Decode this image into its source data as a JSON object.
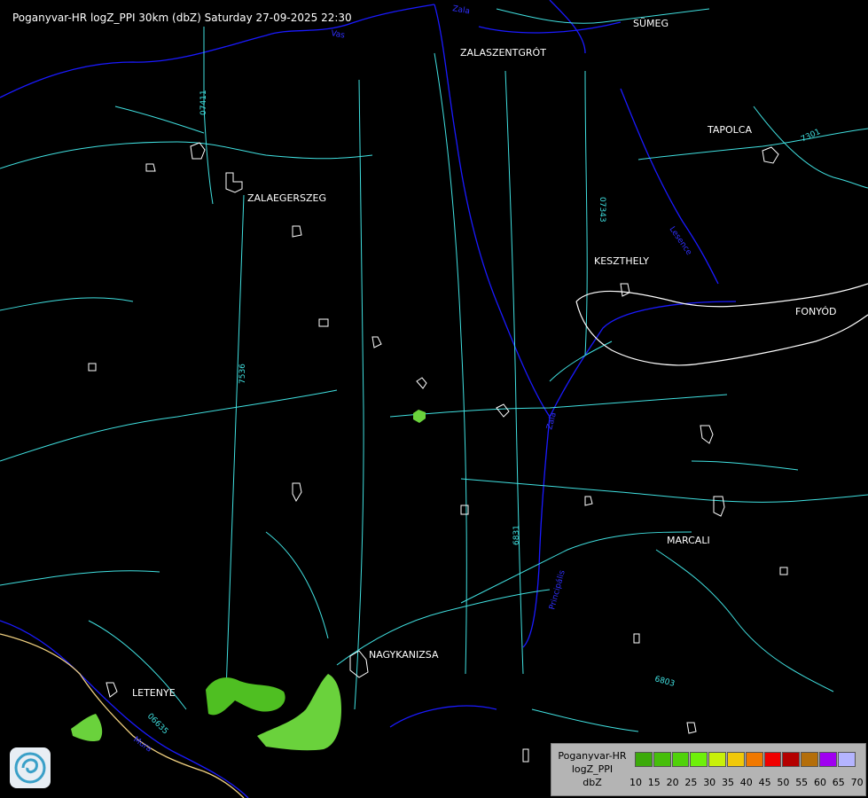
{
  "map": {
    "title": "Poganyvar-HR logZ_PPI 30km (dbZ) Saturday 27-09-2025 22:30",
    "cities": [
      "SÜMEG",
      "ZALASZENTGRÓT",
      "TAPOLCA",
      "ZALAEGERSZEG",
      "KESZTHELY",
      "FONYÓD",
      "MARCALI",
      "NAGYKANIZSA",
      "LETENYE"
    ],
    "road_labels": [
      "07411",
      "07343",
      "7536",
      "6831",
      "6803",
      "06635",
      "7301"
    ],
    "river_labels": [
      "Zala",
      "Vas",
      "Zala",
      "Principális",
      "Lesence",
      "Mura"
    ],
    "colors": {
      "background": "#000000",
      "roads": "#40e0e0",
      "rivers": "#1a1aff",
      "boundaries": "#ffffff",
      "border": "#f0d080",
      "echo_light": "#6ad23c",
      "echo_dark": "#3cb41e"
    }
  },
  "legend": {
    "line1": "Poganyvar-HR",
    "line2": "logZ_PPI",
    "line3": "dbZ",
    "swatch_colors": [
      "#3caa0a",
      "#46be0a",
      "#50d20a",
      "#6ef00a",
      "#c8f00a",
      "#f0c80a",
      "#f07800",
      "#f00000",
      "#b40000",
      "#b46e0a",
      "#a000f0",
      "#b4b4ff"
    ],
    "ticks": [
      "10",
      "15",
      "20",
      "25",
      "30",
      "35",
      "40",
      "45",
      "50",
      "55",
      "60",
      "65",
      "70"
    ]
  },
  "logo": {
    "icon": "met-service-swirl-icon"
  }
}
